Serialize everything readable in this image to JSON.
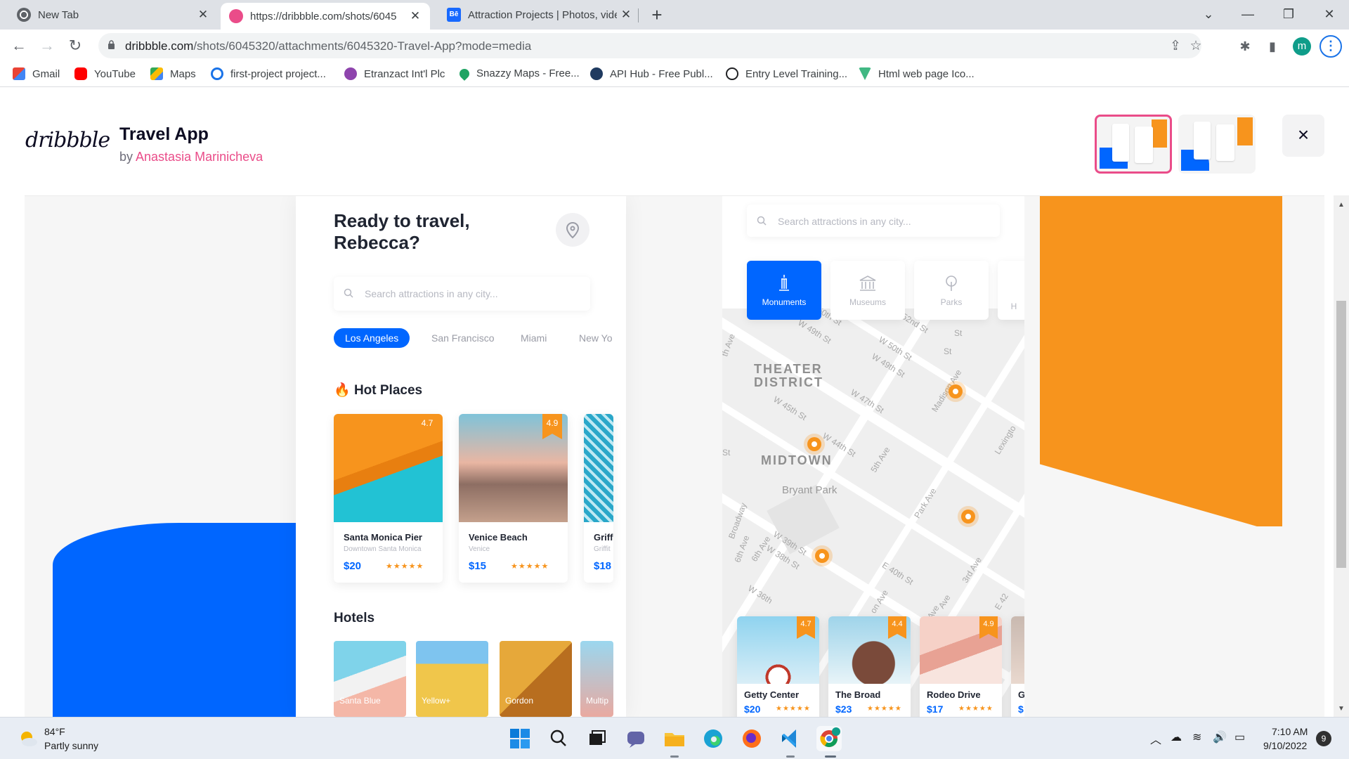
{
  "browser": {
    "tabs": [
      {
        "title": "New Tab",
        "active": false
      },
      {
        "title": "https://dribbble.com/shots/6045",
        "active": true
      },
      {
        "title": "Attraction Projects | Photos, vide",
        "active": false
      }
    ],
    "url_host": "dribbble.com",
    "url_path": "/shots/6045320/attachments/6045320-Travel-App?mode=media",
    "profile_initial": "m",
    "bookmarks": [
      "Gmail",
      "YouTube",
      "Maps",
      "first-project project...",
      "Etranzact Int'l Plc",
      "Snazzy Maps - Free...",
      "API Hub - Free Publ...",
      "Entry Level Training...",
      "Html web page Ico..."
    ]
  },
  "shot": {
    "logo": "dribbble",
    "title": "Travel App",
    "by_prefix": "by",
    "author": "Anastasia Marinicheva",
    "close_icon": "×"
  },
  "phone1": {
    "greeting_line1": "Ready to travel,",
    "greeting_line2": "Rebecca?",
    "search_placeholder": "Search attractions in any city...",
    "cities": [
      "Los Angeles",
      "San Francisco",
      "Miami",
      "New Yo"
    ],
    "hot_places_title": "Hot Places",
    "places": [
      {
        "name": "Santa Monica Pier",
        "sub": "Downtown Santa Monica",
        "price": "$20",
        "rating": "4.7",
        "stars": "★★★★★"
      },
      {
        "name": "Venice Beach",
        "sub": "Venice",
        "price": "$15",
        "rating": "4.9",
        "stars": "★★★★★"
      },
      {
        "name": "Griff",
        "sub": "Griffit",
        "price": "$18",
        "rating": "",
        "stars": ""
      }
    ],
    "hotels_title": "Hotels",
    "hotels": [
      "Santa Blue",
      "Yellow+",
      "Gordon",
      "Multip"
    ]
  },
  "phone2": {
    "search_placeholder": "Search attractions in any city...",
    "categories": [
      "Monuments",
      "Museums",
      "Parks",
      "H"
    ],
    "map_labels": {
      "theater_district": "THEATER\nDISTRICT",
      "midtown": "MIDTOWN",
      "bryant_park": "Bryant Park",
      "streets": [
        "W 50th St",
        "W 49th St",
        "W 52nd St",
        "W 50th St",
        "W 49th St",
        "W 47th St",
        "W 45th St",
        "W 44th St",
        "5th Ave",
        "Madison Ave",
        "Park Ave",
        "Broadway",
        "6th Ave",
        "W 39th St",
        "W 38th St",
        "W 36th",
        "E 40th St",
        "3rd Ave",
        "Lexingto",
        "6th Ave",
        "St",
        "St",
        "St",
        "Ave",
        "on Ave",
        "Ave",
        "E 42",
        "th Ave",
        "St"
      ]
    },
    "attractions": [
      {
        "name": "Getty Center",
        "price": "$20",
        "rating": "4.7",
        "stars": "★★★★★"
      },
      {
        "name": "The Broad",
        "price": "$23",
        "rating": "4.4",
        "stars": "★★★★★"
      },
      {
        "name": "Rodeo Drive",
        "price": "$17",
        "rating": "4.9",
        "stars": "★★★★★"
      },
      {
        "name": "G",
        "price": "$",
        "rating": "",
        "stars": ""
      }
    ]
  },
  "taskbar": {
    "temperature": "84°F",
    "condition": "Partly sunny",
    "time": "7:10 AM",
    "date": "9/10/2022",
    "notifications": "9"
  },
  "colors": {
    "blue": "#0066ff",
    "orange": "#f7941d",
    "dribbble_pink": "#ea4c89"
  }
}
